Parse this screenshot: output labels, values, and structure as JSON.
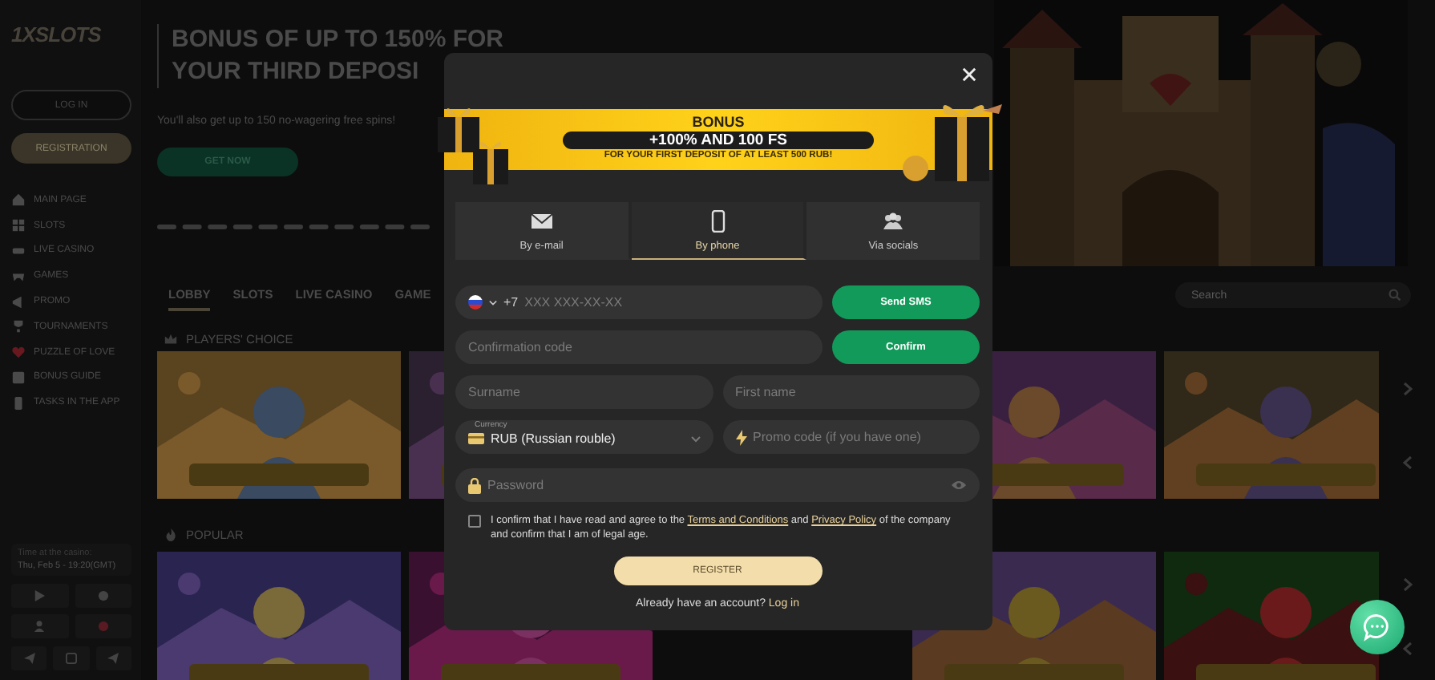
{
  "sidebar": {
    "logo": "1XSLOTS",
    "login_button": "LOG IN",
    "registration_button": "REGISTRATION",
    "nav": [
      {
        "label": "MAIN PAGE"
      },
      {
        "label": "SLOTS"
      },
      {
        "label": "LIVE CASINO"
      },
      {
        "label": "GAMES"
      },
      {
        "label": "PROMO"
      },
      {
        "label": "TOURNAMENTS"
      },
      {
        "label": "PUZZLE OF LOVE"
      },
      {
        "label": "BONUS GUIDE"
      },
      {
        "label": "TASKS IN THE APP"
      }
    ],
    "clock_label": "Time at the casino:",
    "clock_value": "Thu, Feb 5 - 19:20(GMT)"
  },
  "hero": {
    "title": [
      "BONUS OF UP TO 150% FOR",
      "YOUR THIRD DEPOSI"
    ],
    "subtitle": "You'll also get up to 150 no-wagering free spins!",
    "button": "GET NOW"
  },
  "tabs": [
    {
      "label": "LOBBY",
      "selected": true
    },
    {
      "label": "SLOTS",
      "selected": false
    },
    {
      "label": "LIVE CASINO",
      "selected": false
    },
    {
      "label": "GAME",
      "selected": false
    }
  ],
  "search": {
    "placeholder": "Search"
  },
  "sections": [
    {
      "title": "PLAYERS' CHOICE"
    },
    {
      "title": "POPULAR"
    }
  ],
  "modal": {
    "bonus": {
      "heading": "BONUS",
      "offer": "+100% AND 100 FS",
      "condition": "FOR YOUR FIRST DEPOSIT OF AT LEAST 500 RUB!"
    },
    "methods": [
      {
        "label": "By e-mail",
        "selected": false
      },
      {
        "label": "By phone",
        "selected": true
      },
      {
        "label": "Via socials",
        "selected": false
      }
    ],
    "phone": {
      "code": "+7",
      "placeholder": "XXX XXX-XX-XX"
    },
    "send_button": "Send SMS",
    "code_field": {
      "placeholder": "Confirmation code"
    },
    "confirm_button": "Confirm",
    "surname": {
      "placeholder": "Surname"
    },
    "first_name": {
      "placeholder": "First name"
    },
    "currency": {
      "label": "Currency",
      "value": "RUB (Russian rouble)"
    },
    "promo": {
      "placeholder": "Promo code (if you have one)"
    },
    "password": {
      "placeholder": "Password"
    },
    "consent": {
      "checked": false,
      "parts": [
        {
          "kind": "text",
          "text": "I confirm that I have read and agree to the "
        },
        {
          "kind": "link",
          "text": "Terms and Conditions"
        },
        {
          "kind": "text",
          "text": " and "
        },
        {
          "kind": "link",
          "text": "Privacy Policy"
        },
        {
          "kind": "text",
          "text": " of the company and confirm that I am of legal age."
        }
      ]
    },
    "register_button": "REGISTER",
    "login_prompt": "Already have an account?",
    "login_link": "Log in"
  }
}
